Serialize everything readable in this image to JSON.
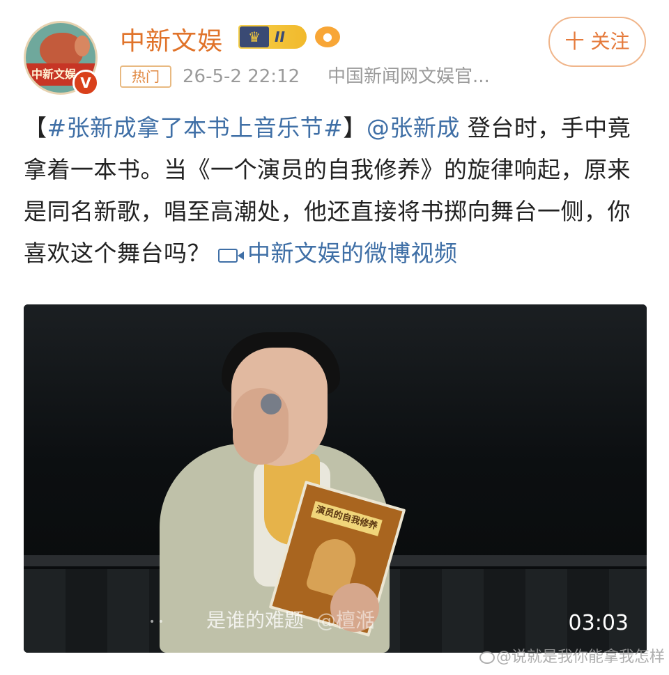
{
  "account": {
    "name": "中新文娱",
    "avatar_text": "中新文娱",
    "verified_mark": "V",
    "rank_label": "II",
    "follow_label": "十 关注"
  },
  "meta": {
    "tag": "热门",
    "time": "26-5-2 22:12",
    "source": "中国新闻网文娱官..."
  },
  "post": {
    "open_bracket": "【",
    "topic": "#张新成拿了本书上音乐节#",
    "close_bracket": "】",
    "mention": "@张新成",
    "body": " 登台时，手中竟拿着一本书。当《一个演员的自我修养》的旋律响起，原来是同名新歌，唱至高潮处，他还直接将书掷向舞台一侧，你喜欢这个舞台吗？ ",
    "video_link": "中新文娱的微博视频"
  },
  "video": {
    "caption": "是谁的难题",
    "caption_watermark": "@檀湉",
    "duration": "03:03",
    "book_title": "演员的自我修养"
  },
  "watermark": {
    "text": "@说就是我你能拿我怎样"
  },
  "colors": {
    "username": "#e0732a",
    "link": "#3f6fa6",
    "follow_border": "#f0b58a"
  },
  "icons": [
    "verified-icon",
    "rank-crown-icon",
    "fish-emoji-icon",
    "video-camera-icon",
    "weibo-icon"
  ]
}
